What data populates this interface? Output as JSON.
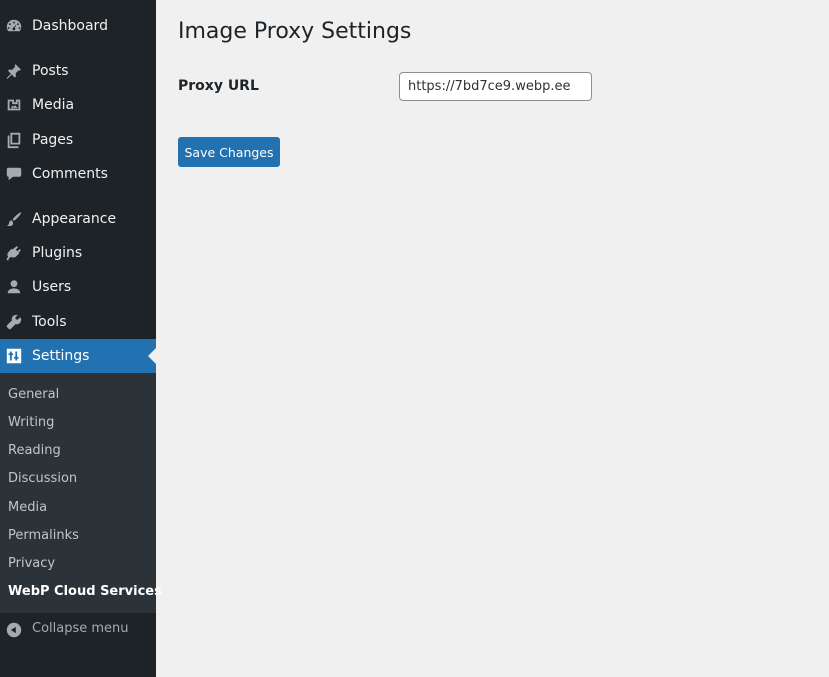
{
  "sidebar": {
    "items": [
      {
        "label": "Dashboard",
        "icon": "dashboard-icon"
      },
      {
        "label": "Posts",
        "icon": "pushpin-icon"
      },
      {
        "label": "Media",
        "icon": "media-icon"
      },
      {
        "label": "Pages",
        "icon": "pages-icon"
      },
      {
        "label": "Comments",
        "icon": "comment-icon"
      },
      {
        "label": "Appearance",
        "icon": "paintbrush-icon"
      },
      {
        "label": "Plugins",
        "icon": "plugin-icon"
      },
      {
        "label": "Users",
        "icon": "user-icon"
      },
      {
        "label": "Tools",
        "icon": "wrench-icon"
      },
      {
        "label": "Settings",
        "icon": "settings-icon",
        "current": true
      }
    ],
    "submenu": [
      "General",
      "Writing",
      "Reading",
      "Discussion",
      "Media",
      "Permalinks",
      "Privacy",
      "WebP Cloud Services"
    ],
    "submenu_current": "WebP Cloud Services",
    "collapse_label": "Collapse menu"
  },
  "main": {
    "title": "Image Proxy Settings",
    "proxy_url_label": "Proxy URL",
    "proxy_url_value": "https://7bd7ce9.webp.ee",
    "save_label": "Save Changes"
  },
  "colors": {
    "sidebar_bg": "#1d2327",
    "submenu_bg": "#2c3338",
    "accent": "#2271b1",
    "page_bg": "#f0f0f1"
  }
}
